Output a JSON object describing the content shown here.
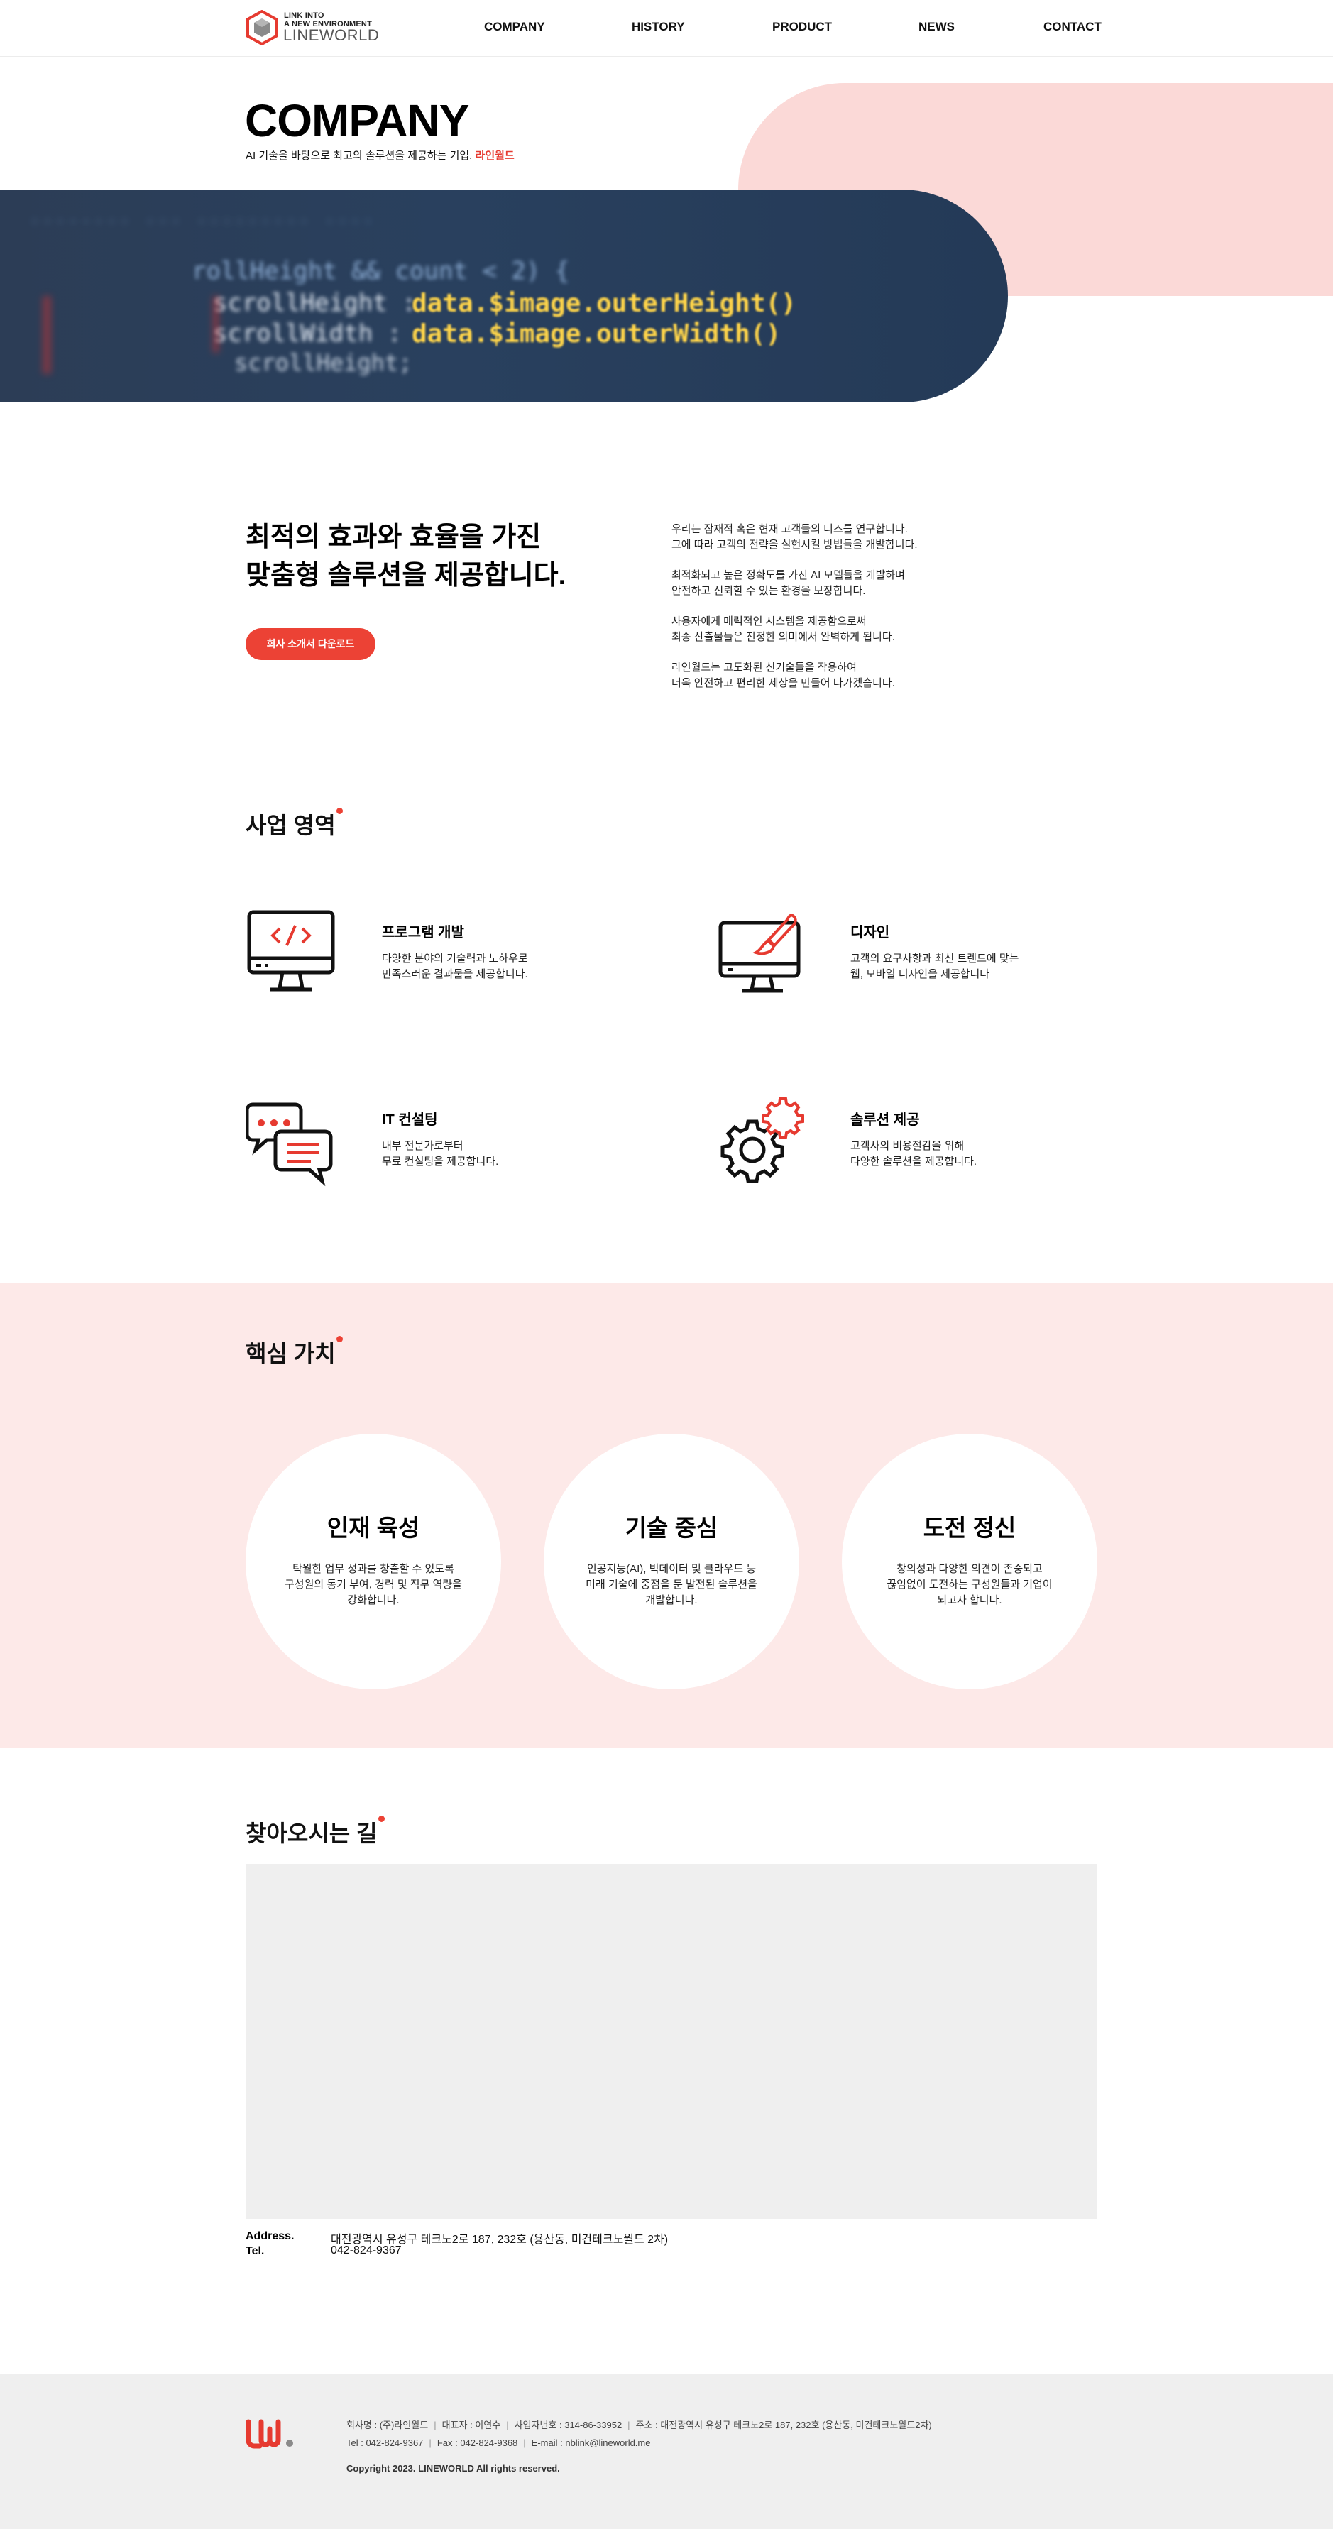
{
  "header": {
    "logo": {
      "line1": "LINK INTO",
      "line2": "A NEW ENVIRONMENT",
      "name": "LINEWORLD"
    },
    "nav": [
      "COMPANY",
      "HISTORY",
      "PRODUCT",
      "NEWS",
      "CONTACT"
    ]
  },
  "hero": {
    "title": "COMPANY",
    "subtitle_prefix": "AI 기술을 바탕으로 최고의 솔루션을 제공하는 기업, ",
    "subtitle_accent": "라인월드",
    "code_line1": "rollHeight && count < 2) {",
    "code_line2a": "scrollHeight : ",
    "code_line2b": "data.$image.outerHeight()",
    "code_line3a": "scrollWidth : ",
    "code_line3b": "data.$image.outerWidth()",
    "code_line4": "scrollHeight;"
  },
  "intro": {
    "title_line1": "최적의 효과와 효율을 가진",
    "title_line2": "맞춤형 솔루션을 제공합니다.",
    "download_button": "회사 소개서 다운로드",
    "paragraphs": [
      [
        "우리는 잠재적 혹은 현재 고객들의 니즈를 연구합니다.",
        "그에 따라 고객의 전략을 실현시킬 방법들을 개발합니다."
      ],
      [
        "최적화되고 높은 정확도를 가진 AI 모델들을 개발하며",
        "안전하고 신뢰할 수 있는 환경을 보장합니다."
      ],
      [
        "사용자에게 매력적인 시스템을 제공함으로써",
        "최종 산출물들은 진정한 의미에서 완벽하게 됩니다."
      ],
      [
        "라인월드는 고도화된 신기술들을 작용하여",
        "더욱 안전하고 편리한 세상을 만들어 나가겠습니다."
      ]
    ]
  },
  "business": {
    "title": "사업 영역",
    "items": [
      {
        "icon": "monitor-code-icon",
        "title": "프로그램 개발",
        "desc": [
          "다양한 분야의 기술력과 노하우로",
          "만족스러운 결과물을 제공합니다."
        ]
      },
      {
        "icon": "monitor-brush-icon",
        "title": "디자인",
        "desc": [
          "고객의 요구사항과 최신 트렌드에 맞는",
          "웹, 모바일 디자인을 제공합니다"
        ]
      },
      {
        "icon": "chat-bubbles-icon",
        "title": "IT 컨설팅",
        "desc": [
          "내부 전문가로부터",
          "무료 컨설팅을 제공합니다."
        ]
      },
      {
        "icon": "gears-icon",
        "title": "솔루션 제공",
        "desc": [
          "고객사의 비용절감을 위해",
          "다양한 솔루션을 제공합니다."
        ]
      }
    ]
  },
  "values": {
    "title": "핵심 가치",
    "items": [
      {
        "title": "인재 육성",
        "desc": [
          "탁월한 업무 성과를 창출할 수 있도록",
          "구성원의 동기 부여, 경력 및 직무 역량을",
          "강화합니다."
        ]
      },
      {
        "title": "기술 중심",
        "desc": [
          "인공지능(AI), 빅데이터 및 클라우드 등",
          "미래 기술에 중점을 둔 발전된 솔루션을",
          "개발합니다."
        ]
      },
      {
        "title": "도전 정신",
        "desc": [
          "창의성과 다양한 의견이 존중되고",
          "끊임없이 도전하는 구성원들과 기업이",
          "되고자 합니다."
        ]
      }
    ]
  },
  "location": {
    "title": "찾아오시는 길",
    "address_label": "Address.",
    "address": "대전광역시 유성구 테크노2로 187, 232호 (용산동, 미건테크노월드 2차)",
    "tel_label": "Tel.",
    "tel": "042-824-9367"
  },
  "footer": {
    "logo": "LW.",
    "line1": [
      "회사명 : (주)라인월드",
      "대표자 : 이연수",
      "사업자번호 : 314-86-33952",
      "주소 : 대전광역시 유성구 테크노2로 187, 232호 (용산동, 미건테크노월드2차)"
    ],
    "line2": [
      "Tel : 042-824-9367",
      "Fax : 042-824-9368",
      "E-mail : nblink@lineworld.me"
    ],
    "copyright": "Copyright 2023. LINEWORLD All rights reserved."
  },
  "colors": {
    "accent": "#ec4235",
    "blob": "#fbd9d7",
    "values_bg": "#fde9e8",
    "footer_bg": "#efefef",
    "map_bg": "#efefef"
  }
}
